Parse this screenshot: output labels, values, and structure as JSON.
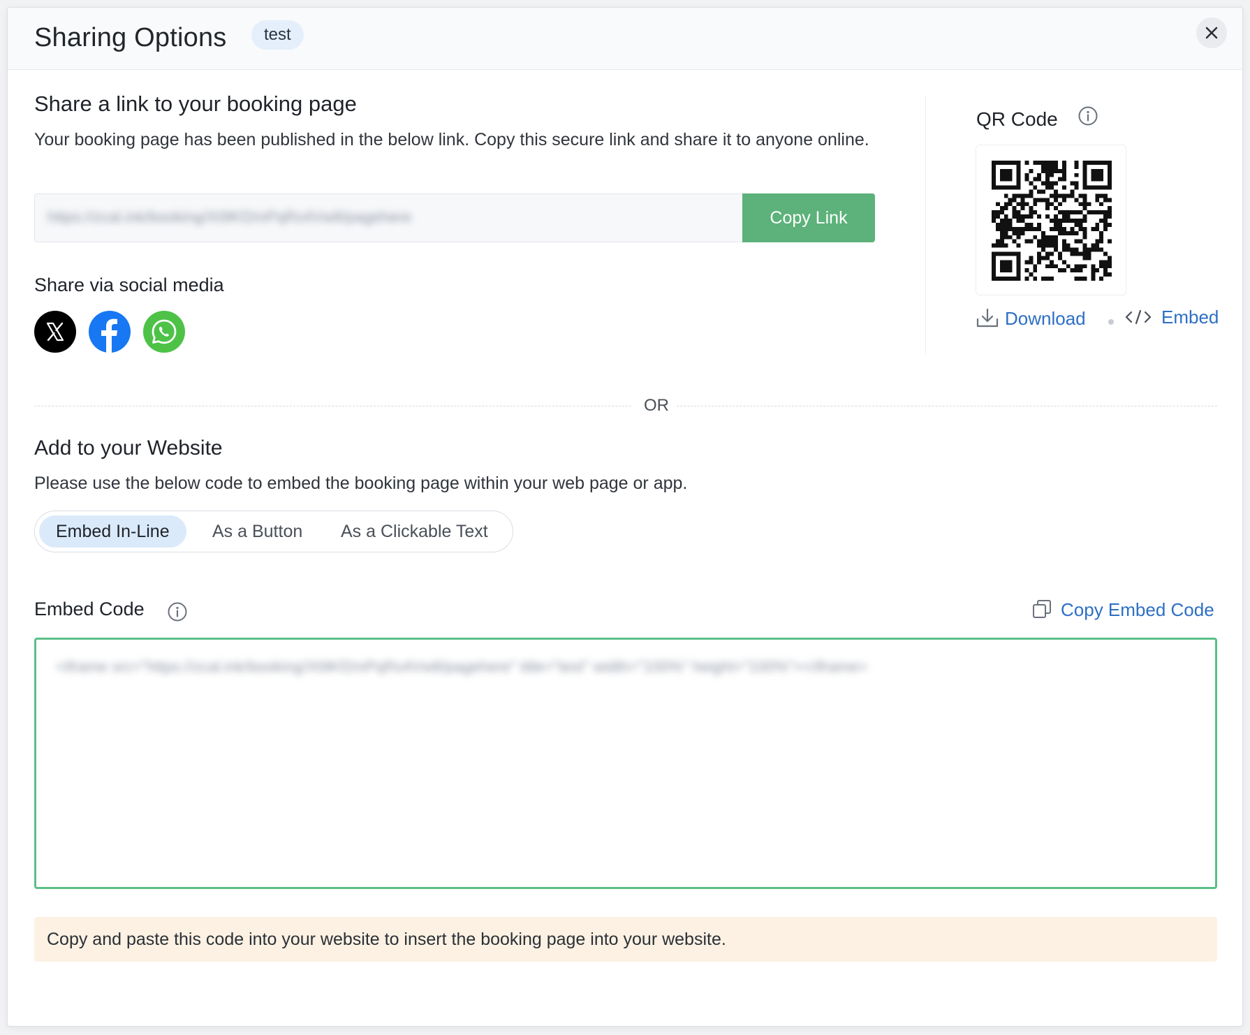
{
  "header": {
    "title": "Sharing Options",
    "tag": "test"
  },
  "share_link": {
    "heading": "Share a link to your booking page",
    "description": "Your booking page has been published in the below link. Copy this secure link and share it to anyone online.",
    "url": "https://zcal.ink/booking/Xt9Kf2mPqRs4Vw8/pagehere",
    "copy_label": "Copy Link"
  },
  "social": {
    "heading": "Share via social media",
    "items": [
      {
        "name": "x",
        "icon": "x-logo-icon",
        "color": "#000000"
      },
      {
        "name": "facebook",
        "icon": "facebook-logo-icon",
        "color": "#1877f2"
      },
      {
        "name": "whatsapp",
        "icon": "whatsapp-logo-icon",
        "color": "#4dc247"
      }
    ]
  },
  "qr": {
    "title": "QR Code",
    "download_label": "Download",
    "embed_label": "Embed"
  },
  "divider_label": "OR",
  "website": {
    "heading": "Add to your Website",
    "description": "Please use the below code to embed the booking page within your web page or app.",
    "tabs": [
      {
        "label": "Embed In-Line",
        "active": true
      },
      {
        "label": "As a Button",
        "active": false
      },
      {
        "label": "As a Clickable Text",
        "active": false
      }
    ],
    "embed_code_label": "Embed Code",
    "copy_embed_label": "Copy Embed Code",
    "embed_code": "<iframe src=\"https://zcal.ink/booking/Xt9Kf2mPqRs4Vw8/pagehere\" title=\"test\" width=\"100%\" height=\"100%\"></iframe>",
    "note": "Copy and paste this code into your website to insert the booking page into your website."
  },
  "colors": {
    "primary_button": "#5cb27a",
    "link": "#2d6fc4",
    "active_tab": "#dbeafa",
    "embed_border": "#5cbf86",
    "note_bg": "#fcf1e3"
  }
}
